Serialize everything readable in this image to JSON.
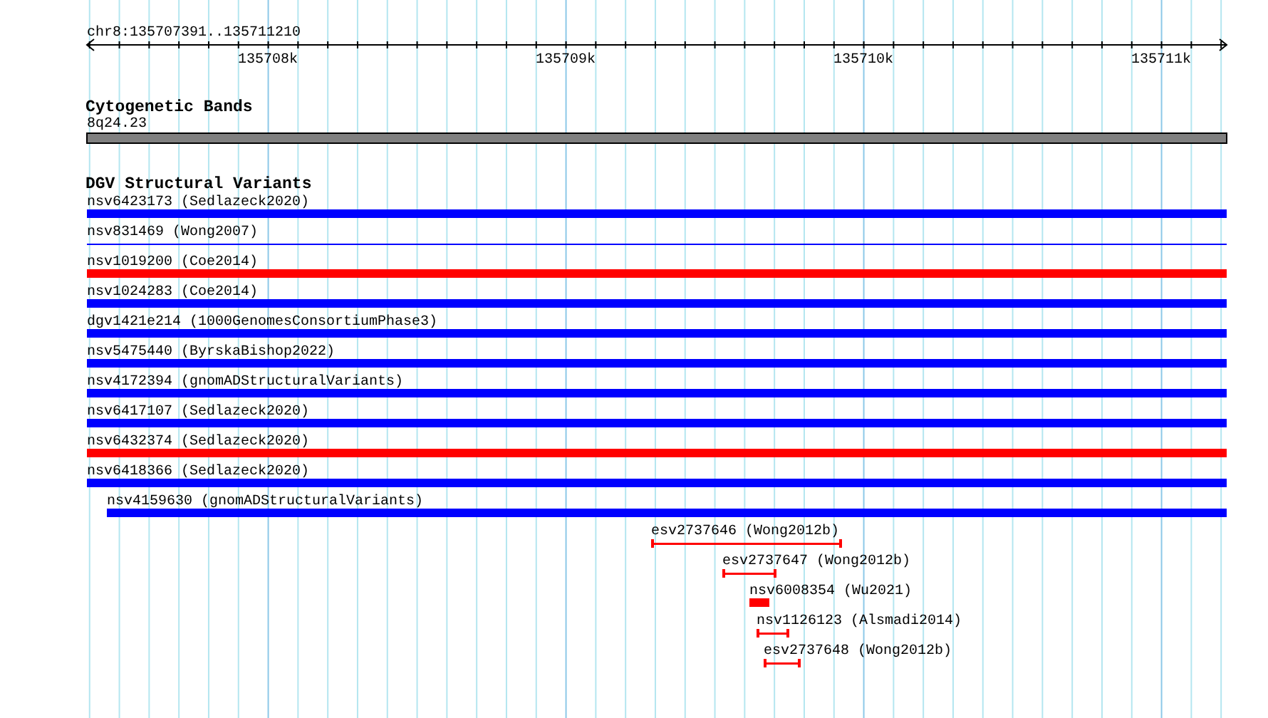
{
  "ruler": {
    "region": "chr8:135707391..135711210",
    "ticks": [
      "135708k",
      "135709k",
      "135710k",
      "135711k"
    ]
  },
  "tracks": [
    {
      "title": "Cytogenetic Bands",
      "features": [
        {
          "kind": "band",
          "label": "8q24.23"
        }
      ]
    },
    {
      "title": "DGV Structural Variants",
      "features": [
        {
          "kind": "bar",
          "label": "nsv6423173 (Sedlazeck2020)",
          "color": "#0000ff"
        },
        {
          "kind": "line",
          "label": "nsv831469 (Wong2007)",
          "color": "#0000ff"
        },
        {
          "kind": "bar",
          "label": "nsv1019200 (Coe2014)",
          "color": "#ff0000"
        },
        {
          "kind": "bar",
          "label": "nsv1024283 (Coe2014)",
          "color": "#0000ff"
        },
        {
          "kind": "bar",
          "label": "dgv1421e214 (1000GenomesConsortiumPhase3)",
          "color": "#0000ff"
        },
        {
          "kind": "bar",
          "label": "nsv5475440 (ByrskaBishop2022)",
          "color": "#0000ff"
        },
        {
          "kind": "bar",
          "label": "nsv4172394 (gnomADStructuralVariants)",
          "color": "#0000ff"
        },
        {
          "kind": "bar",
          "label": "nsv6417107 (Sedlazeck2020)",
          "color": "#0000ff"
        },
        {
          "kind": "bar",
          "label": "nsv6432374 (Sedlazeck2020)",
          "color": "#ff0000"
        },
        {
          "kind": "bar",
          "label": "nsv6418366 (Sedlazeck2020)",
          "color": "#0000ff"
        },
        {
          "kind": "bar",
          "label": "nsv4159630 (gnomADStructuralVariants)",
          "color": "#0000ff"
        },
        {
          "kind": "range",
          "label": "esv2737646 (Wong2012b)",
          "color": "#ff0000"
        },
        {
          "kind": "range",
          "label": "esv2737647 (Wong2012b)",
          "color": "#ff0000"
        },
        {
          "kind": "bar",
          "label": "nsv6008354 (Wu2021)",
          "color": "#ff0000"
        },
        {
          "kind": "range",
          "label": "nsv1126123 (Alsmadi2014)",
          "color": "#ff0000"
        },
        {
          "kind": "range",
          "label": "esv2737648 (Wong2012b)",
          "color": "#ff0000"
        }
      ]
    }
  ]
}
